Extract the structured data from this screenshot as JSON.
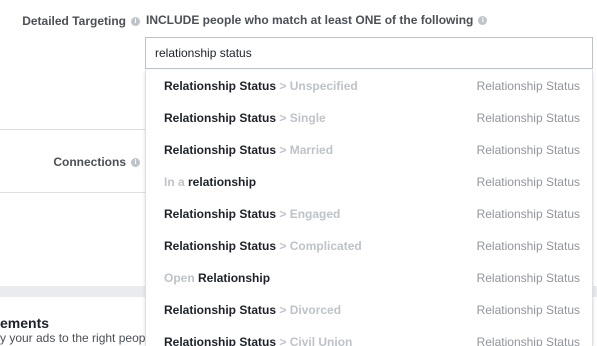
{
  "detailed_targeting": {
    "label": "Detailed Targeting",
    "include_text": "INCLUDE people who match at least ONE of the following"
  },
  "connections": {
    "label": "Connections"
  },
  "search": {
    "value": "relationship status"
  },
  "dropdown": {
    "items": [
      {
        "bold": "Relationship Status",
        "muted": " > Unspecified",
        "category": "Relationship Status",
        "bold_first": true
      },
      {
        "bold": "Relationship Status",
        "muted": " > Single",
        "category": "Relationship Status",
        "bold_first": true
      },
      {
        "bold": "Relationship Status",
        "muted": " > Married",
        "category": "Relationship Status",
        "bold_first": true
      },
      {
        "muted": "In a ",
        "bold": "relationship",
        "category": "Relationship Status",
        "bold_first": false
      },
      {
        "bold": "Relationship Status",
        "muted": " > Engaged",
        "category": "Relationship Status",
        "bold_first": true
      },
      {
        "bold": "Relationship Status",
        "muted": " > Complicated",
        "category": "Relationship Status",
        "bold_first": true
      },
      {
        "muted": "Open ",
        "bold": "Relationship",
        "category": "Relationship Status",
        "bold_first": false
      },
      {
        "bold": "Relationship Status",
        "muted": " > Divorced",
        "category": "Relationship Status",
        "bold_first": true
      },
      {
        "bold": "Relationship Status",
        "muted": " > Civil Union",
        "category": "Relationship Status",
        "bold_first": true
      }
    ]
  },
  "placements": {
    "title": "ements",
    "subtitle": "y your ads to the right people"
  },
  "colors": {
    "text": "#1d2129",
    "muted": "#bec2c9",
    "category": "#90949c",
    "border": "#bdc1c9"
  },
  "icons": {
    "info": "info-icon"
  }
}
